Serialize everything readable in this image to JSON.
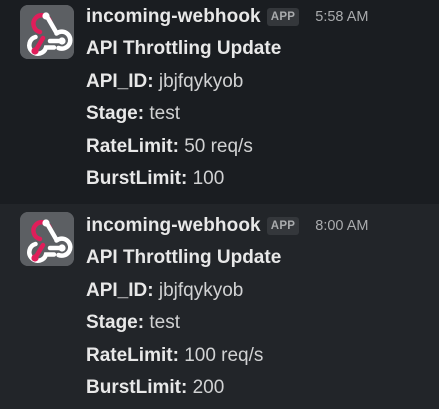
{
  "messages": [
    {
      "sender": "incoming-webhook",
      "badge": "APP",
      "time": "5:58 AM",
      "title": "API Throttling Update",
      "fields": [
        {
          "label": "API_ID",
          "value": "jbjfqykyob"
        },
        {
          "label": "Stage",
          "value": "test"
        },
        {
          "label": "RateLimit",
          "value": "50 req/s"
        },
        {
          "label": "BurstLimit",
          "value": "100"
        }
      ]
    },
    {
      "sender": "incoming-webhook",
      "badge": "APP",
      "time": "8:00 AM",
      "title": "API Throttling Update",
      "fields": [
        {
          "label": "API_ID",
          "value": "jbjfqykyob"
        },
        {
          "label": "Stage",
          "value": "test"
        },
        {
          "label": "RateLimit",
          "value": "100 req/s"
        },
        {
          "label": "BurstLimit",
          "value": "200"
        }
      ]
    }
  ],
  "colors": {
    "background": "#1a1d21",
    "hover_background": "#222529",
    "avatar_bg": "#5c5f63",
    "webhook_pink": "#e01e5a"
  },
  "icons": {
    "avatar": "webhook-icon"
  }
}
